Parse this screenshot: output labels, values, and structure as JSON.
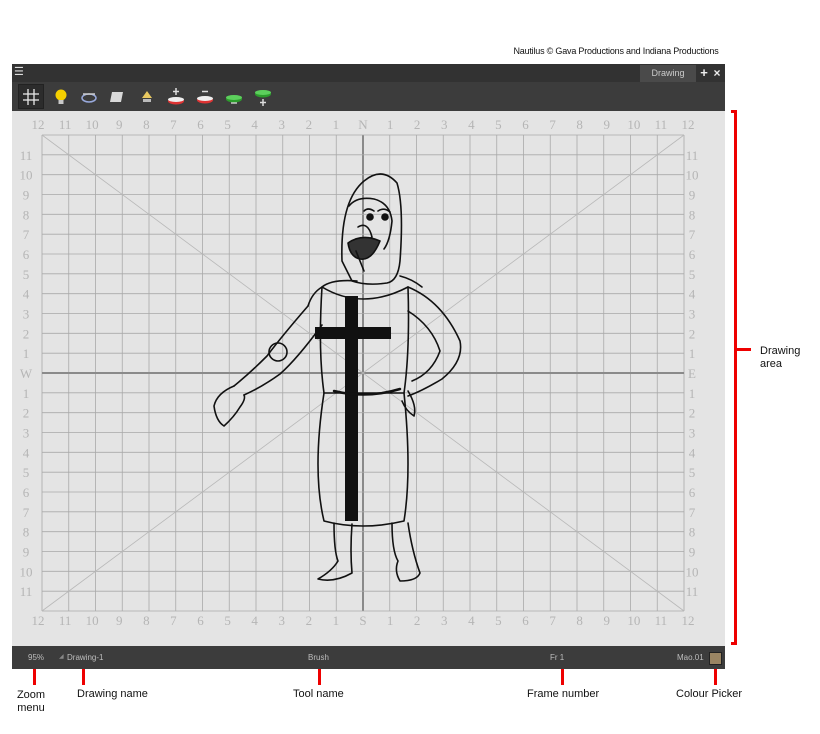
{
  "credit": "Nautilus © Gava Productions and Indiana Productions",
  "view": {
    "tab_label": "Drawing",
    "add_icon": "+",
    "close_icon": "×",
    "menu_icon": "☰"
  },
  "toolbar": {
    "icons": [
      "grid-icon",
      "light-table-icon",
      "onion-skin-icon",
      "background-icon",
      "light-icon",
      "add-layer-icon",
      "remove-layer-icon",
      "layer-green-icon",
      "add-green-layer-icon"
    ]
  },
  "status": {
    "zoom": "95%",
    "drawing_name": "Drawing-1",
    "tool_name": "Brush",
    "frame_number": "Fr 1",
    "colour_name": "Mao.01",
    "colour_swatch": "#9a8563"
  },
  "callouts": {
    "drawing_area": "Drawing area",
    "zoom_menu": "Zoom menu",
    "drawing_name": "Drawing name",
    "tool_name": "Tool name",
    "frame_number": "Frame number",
    "colour_picker": "Colour Picker"
  },
  "colors": {
    "accent": "#e00000",
    "window_bg": "#3c3c3c",
    "canvas_bg": "#e4e4e4"
  },
  "grid": {
    "top_labels": [
      "12",
      "11",
      "10",
      "9",
      "8",
      "7",
      "6",
      "5",
      "4",
      "3",
      "2",
      "1",
      "N",
      "1",
      "2",
      "3",
      "4",
      "5",
      "6",
      "7",
      "8",
      "9",
      "10",
      "11",
      "12"
    ],
    "bottom_labels": [
      "12",
      "11",
      "10",
      "9",
      "8",
      "7",
      "6",
      "5",
      "4",
      "3",
      "2",
      "1",
      "S",
      "1",
      "2",
      "3",
      "4",
      "5",
      "6",
      "7",
      "8",
      "9",
      "10",
      "11",
      "12"
    ],
    "side_labels": [
      "11",
      "10",
      "9",
      "8",
      "7",
      "6",
      "5",
      "4",
      "3",
      "2",
      "1",
      "W",
      "1",
      "2",
      "3",
      "4",
      "5",
      "6",
      "7",
      "8",
      "9",
      "10",
      "11"
    ],
    "right_side_labels": [
      "11",
      "10",
      "9",
      "8",
      "7",
      "6",
      "5",
      "4",
      "3",
      "2",
      "1",
      "E",
      "1",
      "2",
      "3",
      "4",
      "5",
      "6",
      "7",
      "8",
      "9",
      "10",
      "11"
    ]
  }
}
